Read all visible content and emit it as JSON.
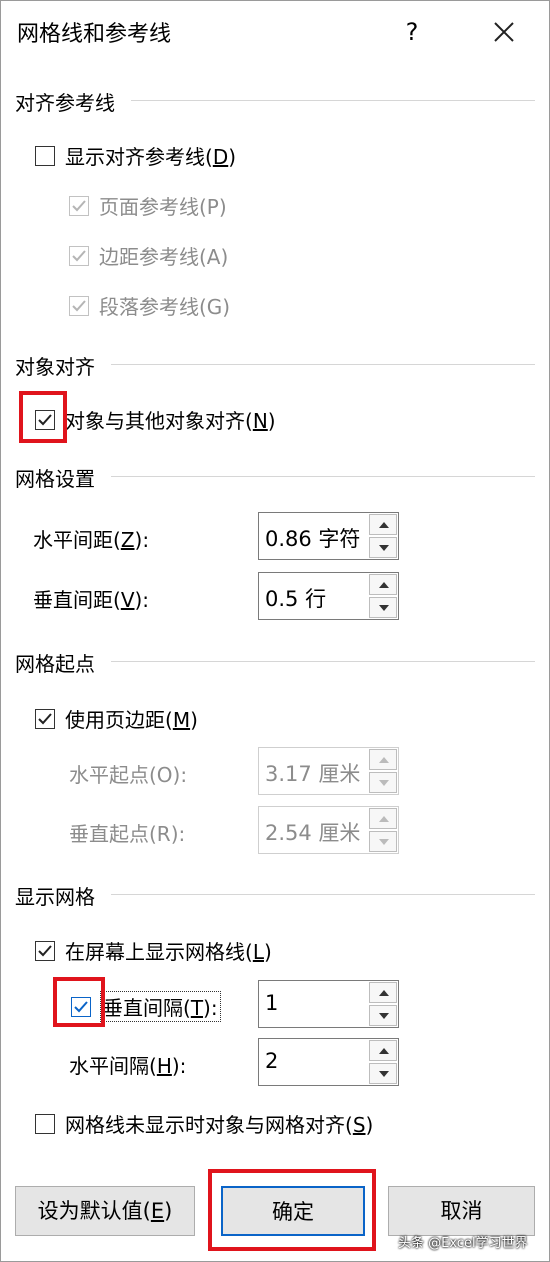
{
  "title": "网格线和参考线",
  "help_label": "?",
  "sections": {
    "align_guides": "对齐参考线",
    "object_snap": "对象对齐",
    "grid_settings": "网格设置",
    "grid_origin": "网格起点",
    "show_grid": "显示网格"
  },
  "align_guides": {
    "show_label": "显示对齐参考线(",
    "show_key": "D",
    "page_label": "页面参考线(P)",
    "margin_label": "边距参考线(A)",
    "paragraph_label": "段落参考线(G)"
  },
  "object_snap": {
    "label": "对象与其他对象对齐(",
    "key": "N"
  },
  "grid_settings": {
    "horizontal_label": "水平间距(",
    "horizontal_key": "Z",
    "horizontal_value": "0.86 字符",
    "vertical_label": "垂直间距(",
    "vertical_key": "V",
    "vertical_value": "0.5 行"
  },
  "grid_origin": {
    "use_margin_label": "使用页边距(",
    "use_margin_key": "M",
    "horizontal_label": "水平起点(O):",
    "horizontal_value": "3.17 厘米",
    "vertical_label": "垂直起点(R):",
    "vertical_value": "2.54 厘米"
  },
  "show_grid": {
    "on_screen_label": "在屏幕上显示网格线(",
    "on_screen_key": "L",
    "vertical_interval_label": "垂直间隔(",
    "vertical_interval_key": "T",
    "vertical_interval_value": "1",
    "horizontal_interval_label": "水平间隔(",
    "horizontal_interval_key": "H",
    "horizontal_interval_value": "2",
    "snap_hidden_label": "网格线未显示时对象与网格对齐(",
    "snap_hidden_key": "S"
  },
  "buttons": {
    "default_label": "设为默认值(",
    "default_key": "E",
    "ok_label": "确定",
    "cancel_label": "取消"
  },
  "watermark": "头条 @Excel学习世界",
  "state": {
    "show_guides": false,
    "page_guides": true,
    "margin_guides": true,
    "paragraph_guides": true,
    "object_snap": true,
    "use_margin": true,
    "show_on_screen": true,
    "vertical_interval": true,
    "snap_hidden": false
  },
  "colors": {
    "highlight": "#e0141c",
    "primary_border": "#0a64c8",
    "disabled_text": "#8c8c8c"
  }
}
